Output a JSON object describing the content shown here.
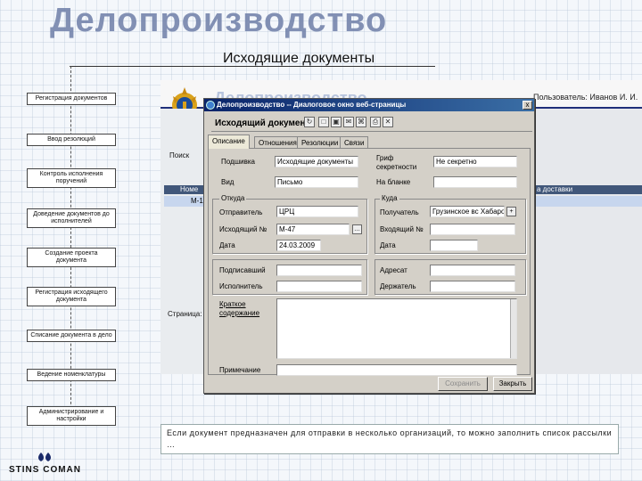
{
  "slide": {
    "title": "Делопроизводство",
    "subtitle": "Исходящие документы"
  },
  "flow": {
    "steps": [
      "Регистрация документов",
      "Ввод резолюций",
      "Контроль исполнения поручений",
      "Доведение документов до исполнителей",
      "Создание проекта документа",
      "Регистрация исходящего документа",
      "Списание документа в дело",
      "Ведение номенклатуры",
      "Администрирование и настройки"
    ]
  },
  "background_app": {
    "brand": "Делопроизводство",
    "user_label": "Пользователь: Иванов И. И.",
    "search_label": "Поиск",
    "column_header_left": "Номе",
    "column_header_right": "а доставки",
    "row_value": "М-1",
    "pages_label": "Страница:"
  },
  "dialog": {
    "titlebar": "Делопроизводство -- Диалоговое окно веб-страницы",
    "close_label": "x",
    "heading": "Исходящий документ",
    "tabs": [
      "Описание",
      "Отношения",
      "Резолюции",
      "Связи"
    ],
    "active_tab": 0,
    "fields": {
      "podshivka_label": "Подшивка",
      "podshivka_value": "Исходящие документы",
      "vid_label": "Вид",
      "vid_value": "Письмо",
      "grif_label": "Гриф секретности",
      "grif_value": "Не секретно",
      "na_blanke_label": "На бланке",
      "na_blanke_value": ""
    },
    "otkuda": {
      "legend": "Откуда",
      "otpravitel_label": "Отправитель",
      "otpravitel_value": "ЦРЦ",
      "ishodyashiy_label": "Исходящий №",
      "ishodyashiy_value": "М-47",
      "data_label": "Дата",
      "data_value": "24.03.2009"
    },
    "kuda": {
      "legend": "Куда",
      "poluchatel_label": "Получатель",
      "poluchatel_value": "Грузинское вс Хабаро",
      "vhodyashiy_label": "Входящий №",
      "vhodyashiy_value": "",
      "data_label": "Дата",
      "data_value": ""
    },
    "podpisal_label": "Подписавший",
    "ispolnitel_label": "Исполнитель",
    "adresat_label": "Адресат",
    "derzhatel_label": "Держатель",
    "kratkoe_label": "Краткое содержание",
    "primechanie_label": "Примечание",
    "btn_save": "Сохранить",
    "btn_close": "Закрыть"
  },
  "note": "Если документ предназначен для отправки в несколько организаций, то можно заполнить список рассылки …",
  "logo": "STINS COMAN"
}
